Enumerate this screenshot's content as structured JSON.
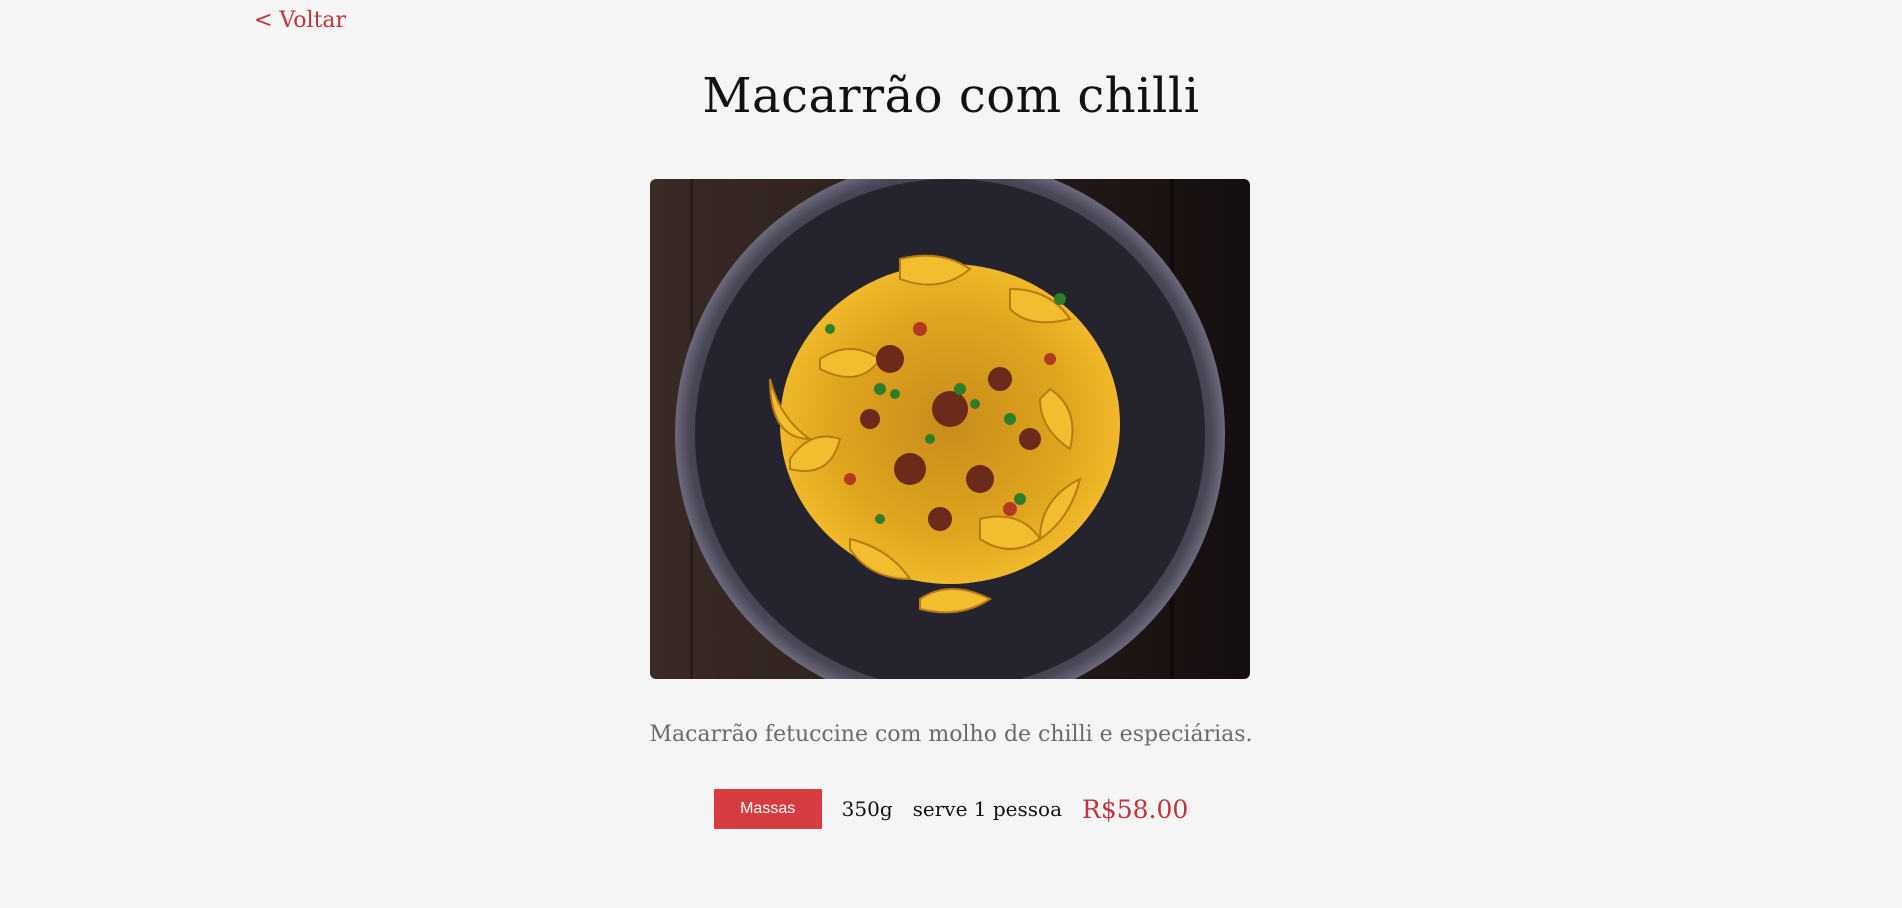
{
  "nav": {
    "back_label": "< Voltar"
  },
  "dish": {
    "title": "Macarrão com chilli",
    "image_alt": "pasta-dish-photo",
    "description": "Macarrão fetuccine com molho de chilli e especiárias.",
    "category": "Massas",
    "weight": "350g",
    "serves": "serve 1 pessoa",
    "price": "R$58.00"
  },
  "colors": {
    "accent": "#c0343a",
    "badge": "#d63b40",
    "background": "#f5f5f5"
  }
}
